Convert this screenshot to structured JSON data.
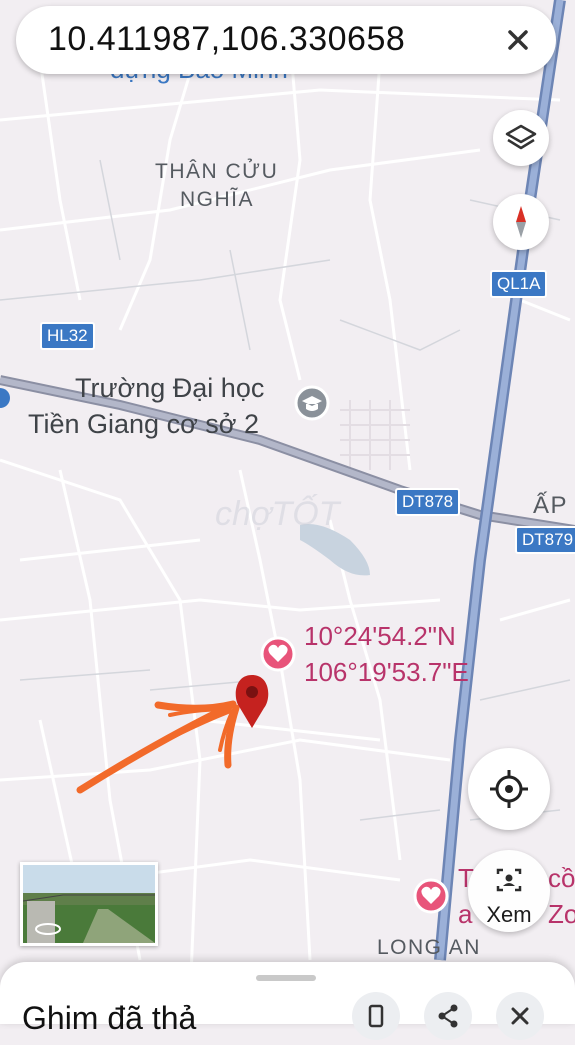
{
  "search": {
    "query": "10.411987,106.330658"
  },
  "map": {
    "area_labels": [
      "THÂN CỬU",
      "NGHĨA",
      "LONG AN"
    ],
    "partial_labels": {
      "top": "dựng Bảo Minh",
      "right": "ẤP"
    },
    "place": {
      "line1": "Trường Đại học",
      "line2": "Tiền Giang cơ sở 2",
      "icon": "graduation-cap-icon"
    },
    "roads": [
      "HL32",
      "QL1A",
      "DT878",
      "DT879"
    ],
    "pin": {
      "lat": "10°24'54.2\"N",
      "lng": "106°19'53.7\"E"
    },
    "poi_partial": {
      "line1": "T",
      "line2": "a",
      "suffix1": "cồ",
      "suffix2": "Zo"
    },
    "watermark": "chợTỐT"
  },
  "controls": {
    "layers_icon": "layers-icon",
    "compass_icon": "compass-icon",
    "locate_icon": "my-location-icon",
    "street_view_label": "Xem"
  },
  "colors": {
    "road_blue": "#3b78c4",
    "pin_red": "#c5221f",
    "poi_pink": "#e8547a",
    "arrow_orange": "#f26a2a"
  },
  "bottom_sheet": {
    "title": "Ghim đã thả"
  }
}
